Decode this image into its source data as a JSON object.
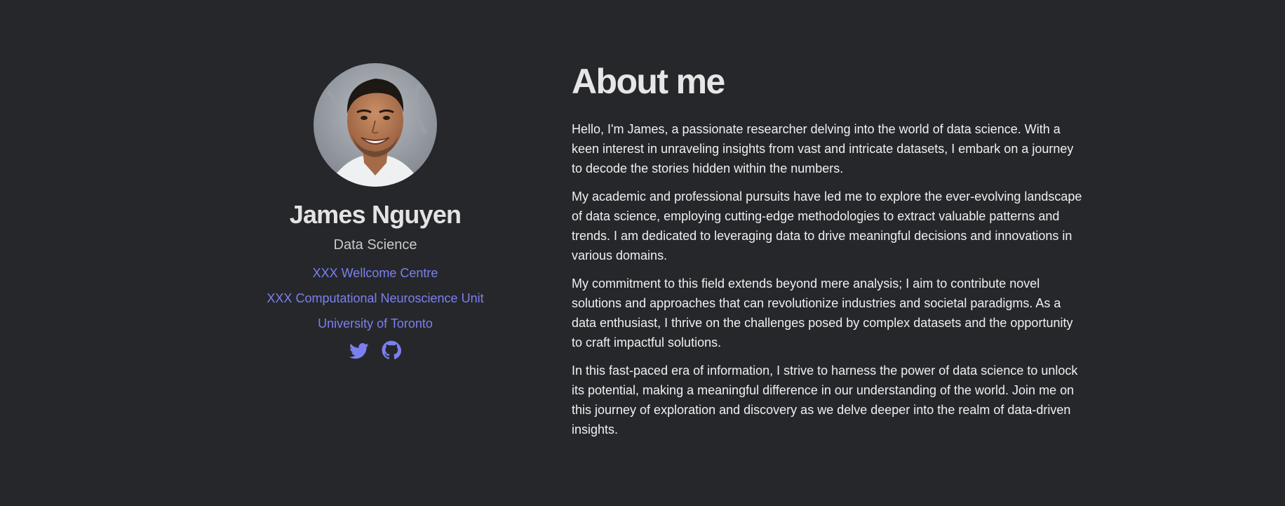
{
  "profile": {
    "avatar_icon": "portrait-photo",
    "name": "James Nguyen",
    "role": "Data Science",
    "affiliations": [
      "XXX Wellcome Centre",
      "XXX Computational Neuroscience Unit",
      "University of Toronto"
    ],
    "socials": [
      {
        "icon": "twitter-icon"
      },
      {
        "icon": "github-icon"
      }
    ]
  },
  "about": {
    "title": "About me",
    "paragraphs": [
      "Hello, I'm James, a passionate researcher delving into the world of data science. With a keen interest in unraveling insights from vast and intricate datasets, I embark on a journey to decode the stories hidden within the numbers.",
      "My academic and professional pursuits have led me to explore the ever-evolving landscape of data science, employing cutting-edge methodologies to extract valuable patterns and trends. I am dedicated to leveraging data to drive meaningful decisions and innovations in various domains.",
      "My commitment to this field extends beyond mere analysis; I aim to contribute novel solutions and approaches that can revolutionize industries and societal paradigms. As a data enthusiast, I thrive on the challenges posed by complex datasets and the opportunity to craft impactful solutions.",
      "In this fast-paced era of information, I strive to harness the power of data science to unlock its potential, making a meaningful difference in our understanding of the world. Join me on this journey of exploration and discovery as we delve deeper into the realm of data-driven insights."
    ]
  },
  "colors": {
    "background": "#26272b",
    "link": "#7b80ee",
    "heading": "#e6e6e6",
    "text": "#f0f0f0"
  }
}
